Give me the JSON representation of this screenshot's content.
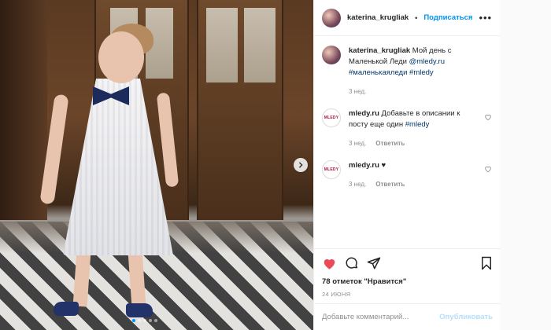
{
  "post": {
    "author": "katerina_krugliak",
    "follow_label": "Подписаться",
    "separator": "•",
    "more_label": "•••"
  },
  "caption": {
    "author": "katerina_krugliak",
    "text": "Мой день с Маленькой Леди",
    "mention": "@mledy.ru",
    "hashtags": [
      "#маленькаяледи",
      "#mledy"
    ],
    "time": "3 нед."
  },
  "comments": [
    {
      "author": "mledy.ru",
      "avatar_text": "MLEDY",
      "text": "Добавьте в описании к посту еще один",
      "tag": "#mledy",
      "time": "3 нед.",
      "reply_label": "Ответить"
    },
    {
      "author": "mledy.ru",
      "avatar_text": "MLEDY",
      "text": "♥",
      "time": "3 нед.",
      "reply_label": "Ответить"
    }
  ],
  "stats": {
    "likes": "78 отметок \"Нравится\"",
    "date": "24 июня"
  },
  "composer": {
    "placeholder": "Добавьте комментарий...",
    "publish_label": "Опубликовать"
  },
  "colors": {
    "accent": "#0095f6",
    "like_red": "#ed4956",
    "text": "#262626",
    "muted": "#8e8e8e"
  }
}
